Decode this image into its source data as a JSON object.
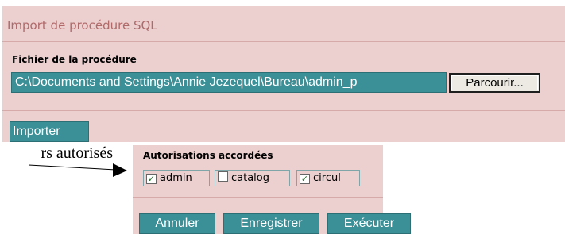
{
  "import_form": {
    "title": "Import de procédure SQL",
    "file_label": "Fichier de la procédure",
    "file_value": "C:\\Documents and Settings\\Annie Jezequel\\Bureau\\admin_p",
    "browse_label": "Parcourir...",
    "import_label": "Importer"
  },
  "annotation": {
    "text": "rs autorisés"
  },
  "authorizations": {
    "label": "Autorisations accordées",
    "items": [
      {
        "label": "admin",
        "checked": true
      },
      {
        "label": "catalog",
        "checked": false
      },
      {
        "label": "circul",
        "checked": true
      }
    ]
  },
  "actions": {
    "cancel_label": "Annuler",
    "save_label": "Enregistrer",
    "execute_label": "Exécuter"
  },
  "colors": {
    "panel_bg": "#eccfcf",
    "button_teal": "#3b8f96",
    "title_color": "#b06a6a",
    "check_mark": "#2a6b30"
  }
}
